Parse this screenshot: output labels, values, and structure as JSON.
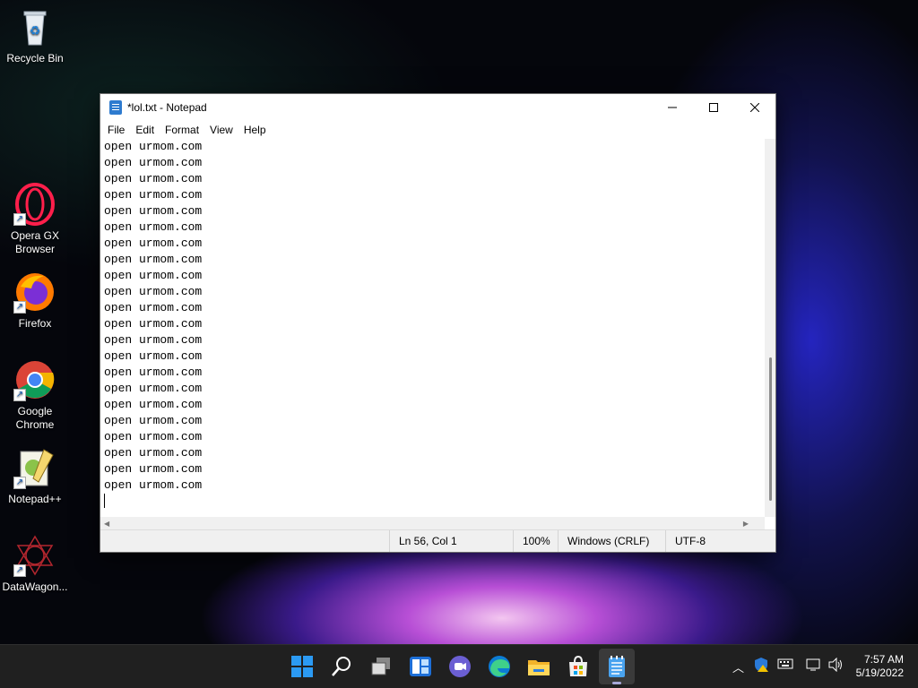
{
  "desktop": {
    "icons": [
      {
        "label": "Recycle Bin"
      },
      {
        "label": "Opera GX Browser"
      },
      {
        "label": "Firefox"
      },
      {
        "label": "Google Chrome"
      },
      {
        "label": "Notepad++"
      },
      {
        "label": "DataWagon..."
      }
    ]
  },
  "window": {
    "title": "*lol.txt - Notepad",
    "menu": [
      "File",
      "Edit",
      "Format",
      "View",
      "Help"
    ],
    "lines": [
      "open urmom.com",
      "open urmom.com",
      "open urmom.com",
      "open urmom.com",
      "open urmom.com",
      "open urmom.com",
      "open urmom.com",
      "open urmom.com",
      "open urmom.com",
      "open urmom.com",
      "open urmom.com",
      "open urmom.com",
      "open urmom.com",
      "open urmom.com",
      "open urmom.com",
      "open urmom.com",
      "open urmom.com",
      "open urmom.com",
      "open urmom.com",
      "open urmom.com",
      "open urmom.com",
      "open urmom.com"
    ],
    "status": {
      "position": "Ln 56, Col 1",
      "zoom": "100%",
      "line_ending": "Windows (CRLF)",
      "encoding": "UTF-8"
    }
  },
  "taskbar": {
    "apps": [
      "start-icon",
      "search-icon",
      "task-view-icon",
      "widgets-icon",
      "teams-chat-icon",
      "edge-icon",
      "file-explorer-icon",
      "store-icon",
      "notepad-icon"
    ],
    "clock": {
      "time": "7:57 AM",
      "date": "5/19/2022"
    }
  }
}
